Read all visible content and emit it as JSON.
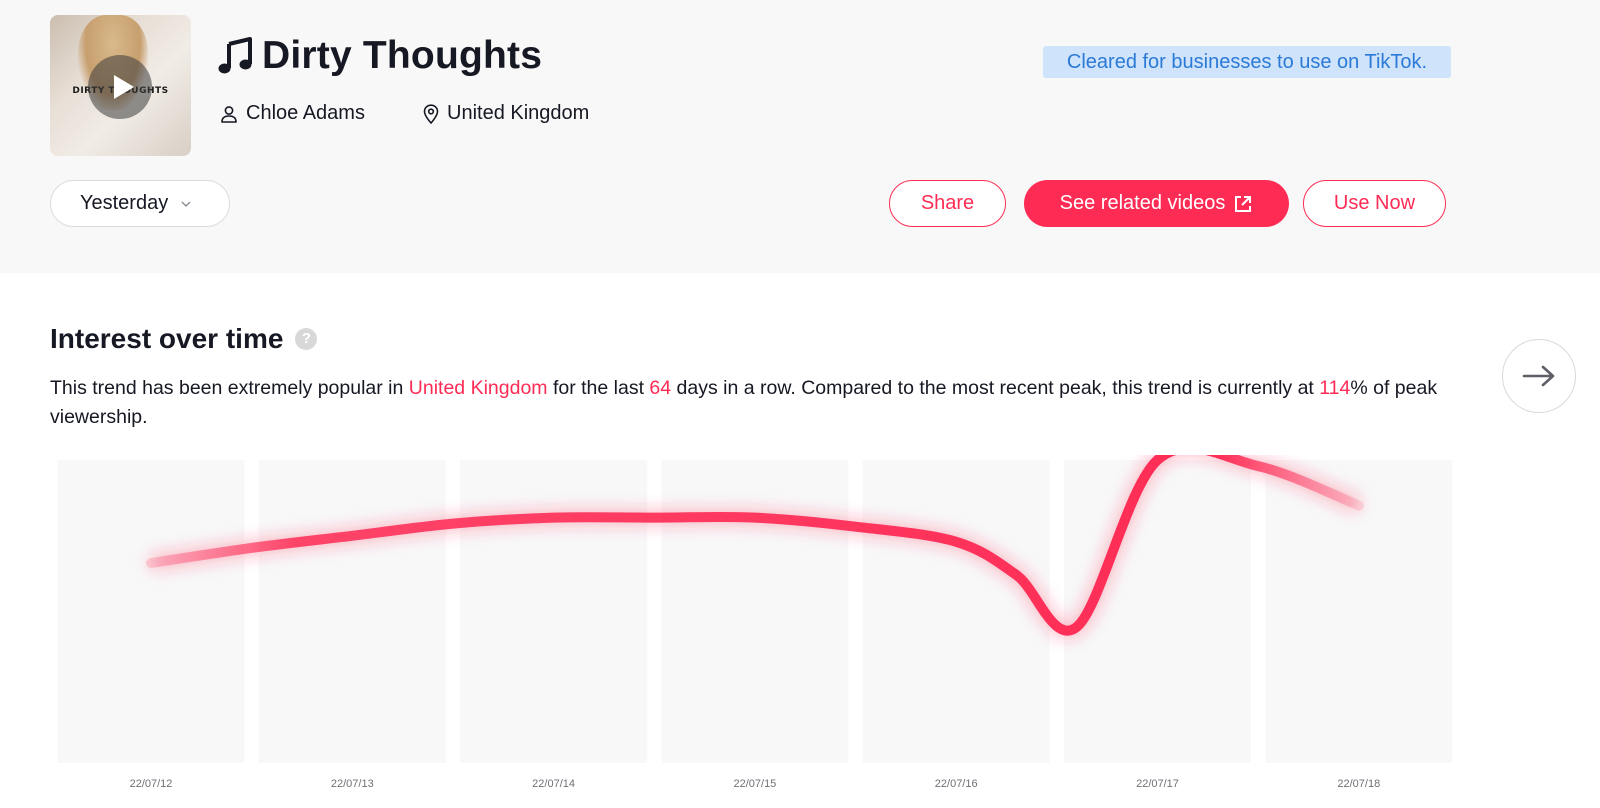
{
  "track": {
    "title": "Dirty Thoughts",
    "artist": "Chloe Adams",
    "country": "United Kingdom",
    "cover_text": "DIRTY THOUGHTS",
    "cleared_badge": "Cleared for businesses to use on TikTok."
  },
  "controls": {
    "period": "Yesterday",
    "share_label": "Share",
    "related_label": "See related videos",
    "use_label": "Use Now"
  },
  "interest": {
    "title": "Interest over time",
    "help_glyph": "?",
    "desc_part1": "This trend has been extremely popular in ",
    "desc_country": "United Kingdom",
    "desc_part2": " for the last ",
    "desc_days": "64",
    "desc_part3": " days in a row. Compared to the most recent peak, this trend is currently at ",
    "desc_percent": "114",
    "desc_part4": "% of peak viewership."
  },
  "colors": {
    "accent": "#fe2c55",
    "badge_bg": "#cfe3fb",
    "badge_text": "#2b7ad6",
    "header_bg": "#f8f8f8"
  },
  "icons": {
    "title": "music-note-icon",
    "artist": "person-icon",
    "country": "location-pin-icon",
    "period": "chevron-down-icon",
    "related": "external-link-icon",
    "next": "arrow-right-icon"
  },
  "chart_data": {
    "type": "line",
    "title": "",
    "xlabel": "",
    "ylabel": "",
    "categories": [
      "22/07/12",
      "22/07/13",
      "22/07/14",
      "22/07/15",
      "22/07/16",
      "22/07/17",
      "22/07/18"
    ],
    "x": [
      0,
      0.5,
      1,
      1.5,
      2,
      2.5,
      3,
      3.5,
      4,
      4.3,
      4.6,
      5,
      5.5,
      6
    ],
    "y": [
      0.66,
      0.71,
      0.75,
      0.79,
      0.81,
      0.81,
      0.81,
      0.78,
      0.73,
      0.62,
      0.45,
      1.0,
      0.98,
      0.85
    ],
    "ylim": [
      0,
      1
    ],
    "grid": false
  }
}
